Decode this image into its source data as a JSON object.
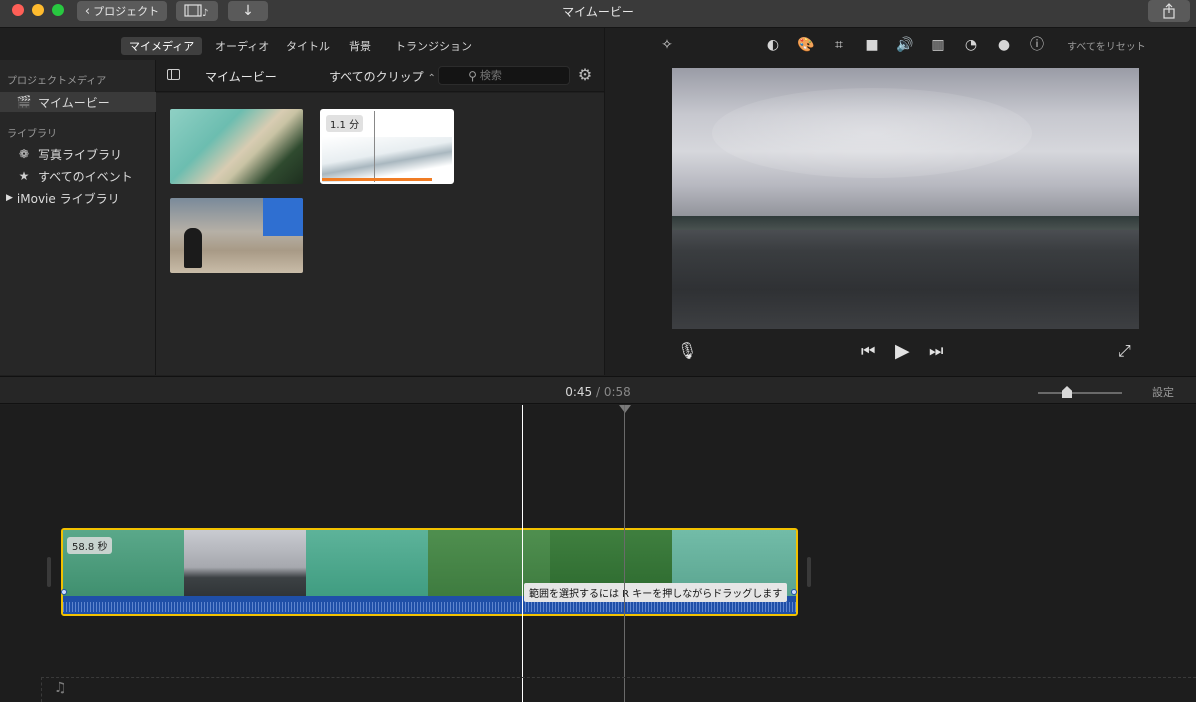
{
  "window": {
    "title": "マイムービー",
    "back_button_label": "プロジェクト",
    "colors": {
      "red": "#fe5f57",
      "yellow": "#febb2e",
      "green": "#28c840"
    }
  },
  "browser_tabs": [
    {
      "label": "マイメディア",
      "active": true
    },
    {
      "label": "オーディオ",
      "active": false
    },
    {
      "label": "タイトル",
      "active": false
    },
    {
      "label": "背景",
      "active": false
    },
    {
      "label": "トランジション",
      "active": false
    }
  ],
  "sidebar": {
    "project_media_heading": "プロジェクトメディア",
    "project_item": "マイムービー",
    "library_heading": "ライブラリ",
    "items": [
      {
        "label": "写真ライブラリ",
        "icon": "flower-icon"
      },
      {
        "label": "すべてのイベント",
        "icon": "star-icon"
      },
      {
        "label": "iMovie ライブラリ",
        "icon": "disclosure-triangle-icon"
      }
    ]
  },
  "browser_header": {
    "title": "マイムービー",
    "filter": "すべてのクリップ",
    "search_placeholder": "検索"
  },
  "clips": [
    {
      "name": "aerial-beach"
    },
    {
      "name": "ocean-waves",
      "duration_badge": "1.1 分"
    },
    {
      "name": "runner-beach"
    }
  ],
  "viewer": {
    "toolbar_icons": [
      "magic-wand-icon",
      "color-balance-icon",
      "palette-icon",
      "crop-icon",
      "stabilization-camera-icon",
      "volume-icon",
      "equalizer-icon",
      "speedometer-icon",
      "filter-icon",
      "info-icon"
    ],
    "reset_all": "すべてをリセット"
  },
  "timeline": {
    "current_time": "0:45",
    "separator": "/",
    "total_time": "0:58",
    "settings_label": "設定",
    "zoom_level": 0.35,
    "clip_duration": "58.8 秒",
    "tooltip": "範囲を選択するには R キーを押しながらドラッグします",
    "clip_border_color": "#f2c100",
    "audio_color": "#1f4fa8"
  }
}
